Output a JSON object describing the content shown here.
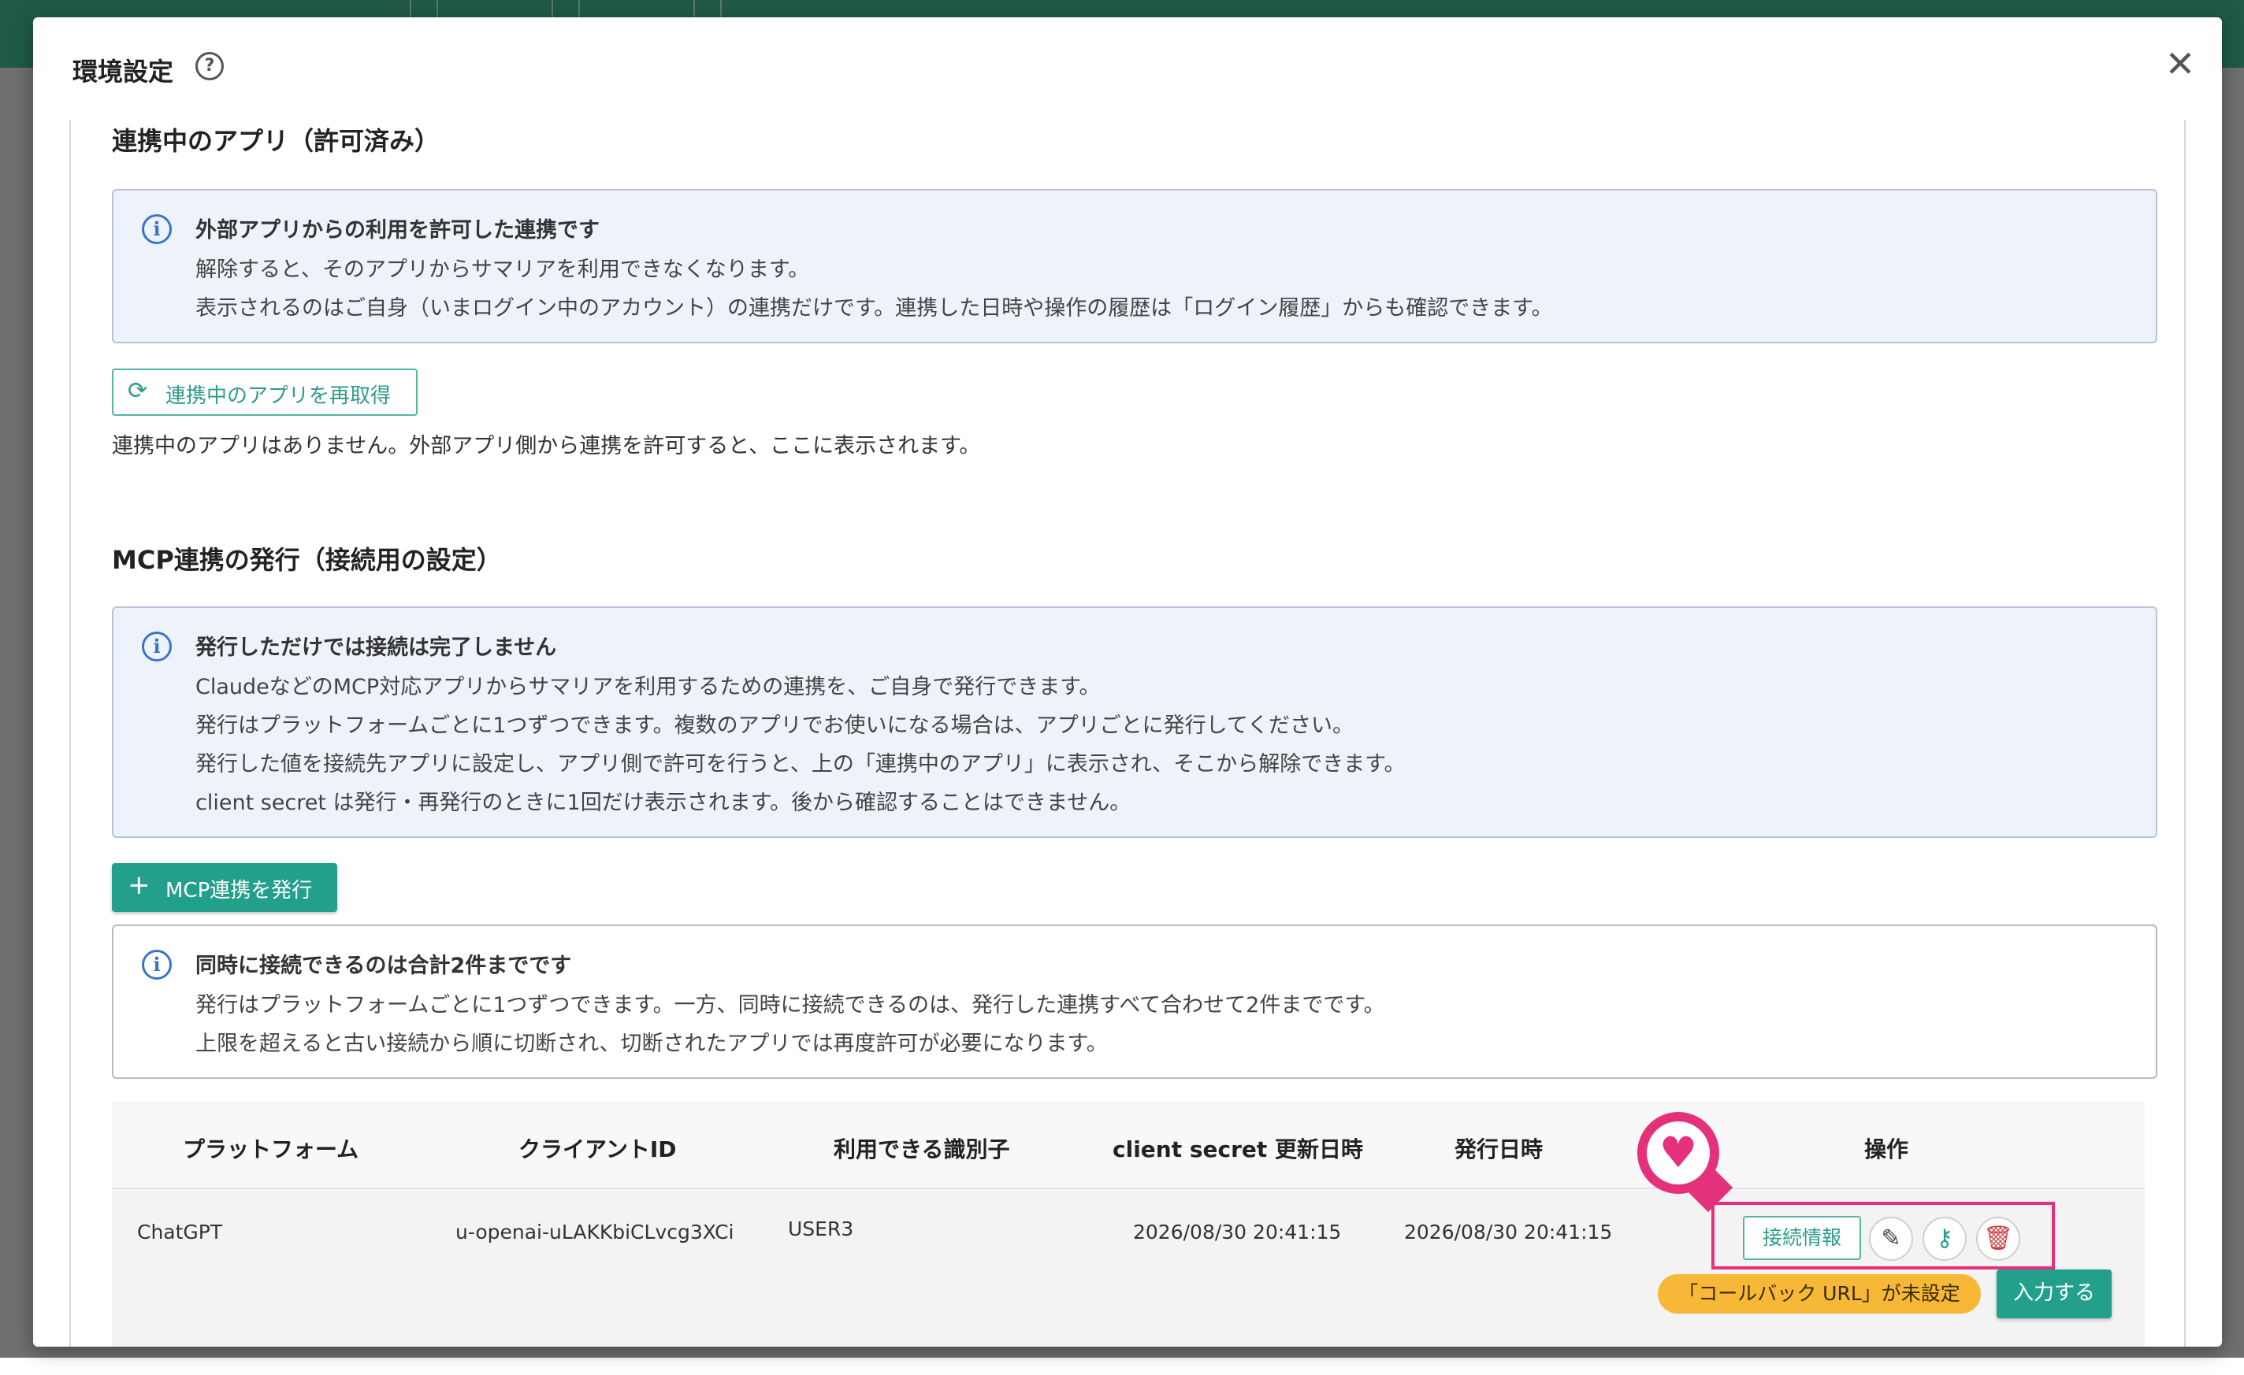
{
  "background": {
    "header_color": "#1f5a44"
  },
  "modal": {
    "title": "環境設定",
    "help_icon": "?",
    "close_icon": "✕"
  },
  "section1": {
    "heading": "連携中のアプリ（許可済み）",
    "info": {
      "title": "外部アプリからの利用を許可した連携です",
      "lines": [
        "解除すると、そのアプリからサマリアを利用できなくなります。",
        "表示されるのはご自身（いまログイン中のアカウント）の連携だけです。連携した日時や操作の履歴は「ログイン履歴」からも確認できます。"
      ]
    },
    "refresh_button": "連携中のアプリを再取得",
    "empty_text": "連携中のアプリはありません。外部アプリ側から連携を許可すると、ここに表示されます。"
  },
  "section2": {
    "heading": "MCP連携の発行（接続用の設定）",
    "info": {
      "title": "発行しただけでは接続は完了しません",
      "lines": [
        "ClaudeなどのMCP対応アプリからサマリアを利用するための連携を、ご自身で発行できます。",
        "発行はプラットフォームごとに1つずつできます。複数のアプリでお使いになる場合は、アプリごとに発行してください。",
        "発行した値を接続先アプリに設定し、アプリ側で許可を行うと、上の「連携中のアプリ」に表示され、そこから解除できます。",
        "client secret は発行・再発行のときに1回だけ表示されます。後から確認することはできません。"
      ]
    },
    "issue_button": "MCP連携を発行",
    "limit_info": {
      "title": "同時に接続できるのは合計2件までです",
      "lines": [
        "発行はプラットフォームごとに1つずつできます。一方、同時に接続できるのは、発行した連携すべて合わせて2件までです。",
        "上限を超えると古い接続から順に切断され、切断されたアプリでは再度許可が必要になります。"
      ]
    }
  },
  "table": {
    "headers": [
      "プラットフォーム",
      "クライアントID",
      "利用できる識別子",
      "client secret 更新日時",
      "発行日時",
      "操作"
    ],
    "rows": [
      {
        "platform": "ChatGPT",
        "client_id": "u-openai-uLAKKbiCLvcg3XCi",
        "identifier": "USER3",
        "secret_updated": "2026/08/30 20:41:15",
        "issued": "2026/08/30 20:41:15",
        "actions": {
          "connection_info": "接続情報",
          "edit_icon": "pencil-icon",
          "key_icon": "key-icon",
          "delete_icon": "trash-icon"
        },
        "warning": "「コールバック URL」が未設定",
        "input_button": "入力する"
      }
    ]
  },
  "colors": {
    "accent": "#23a08b",
    "highlight": "#e5317b",
    "warning": "#f7b838",
    "delete": "#d23a3a",
    "info": "#3a73c9"
  }
}
